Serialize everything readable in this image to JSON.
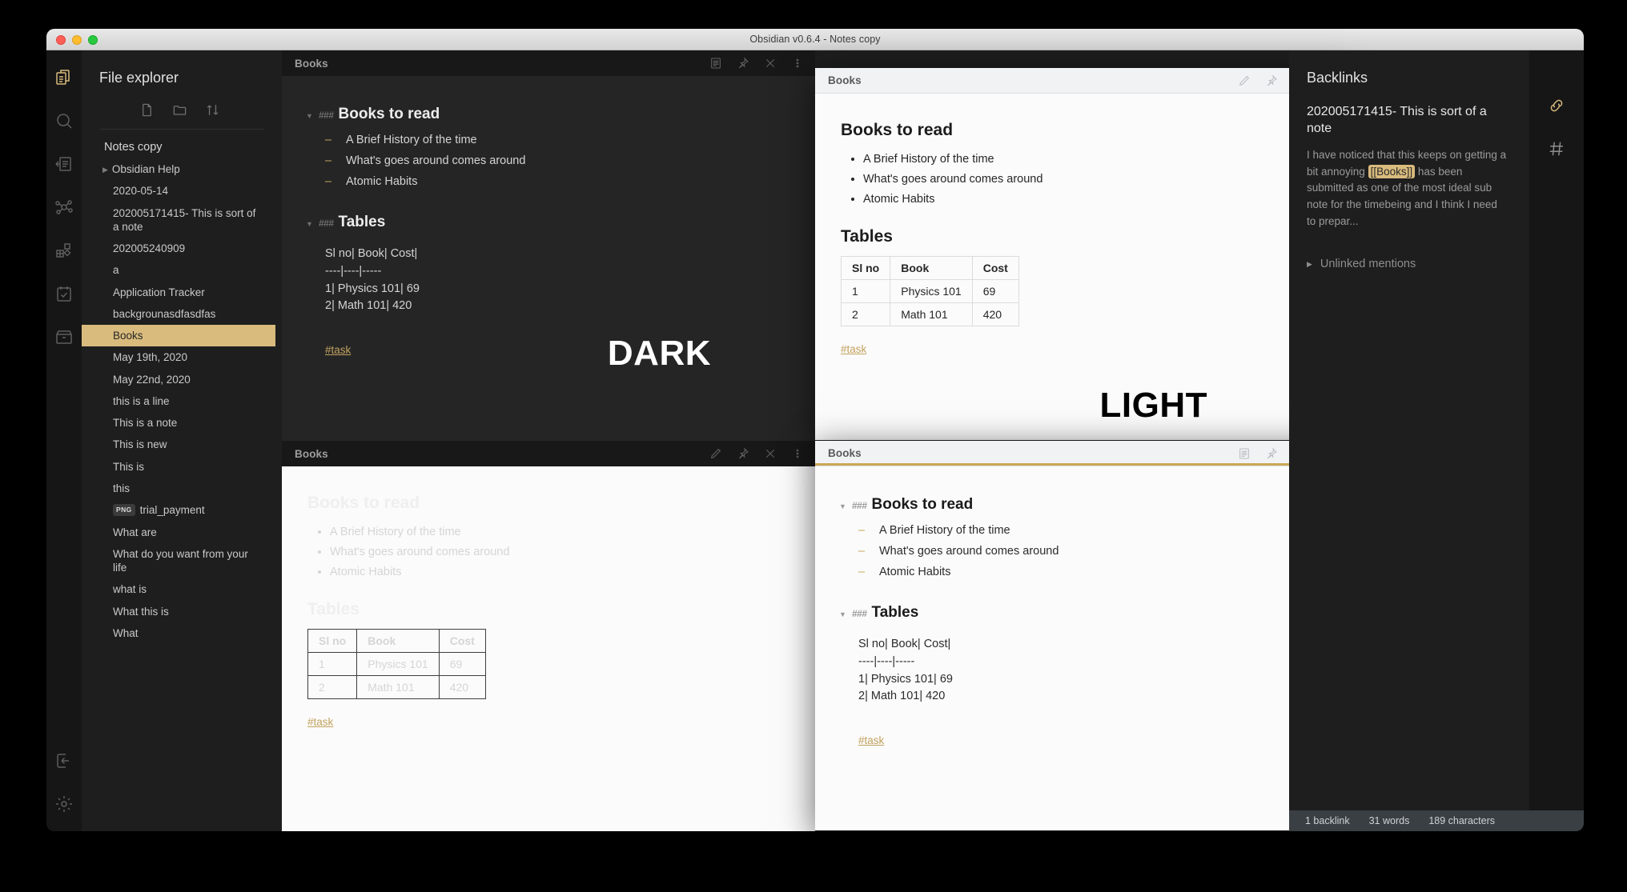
{
  "window": {
    "title": "Obsidian v0.6.4 - Notes copy"
  },
  "sidebar": {
    "title": "File explorer",
    "vault": "Notes copy",
    "tools": [
      {
        "name": "new-note-icon",
        "label": "New note"
      },
      {
        "name": "new-folder-icon",
        "label": "New folder"
      },
      {
        "name": "sort-icon",
        "label": "Change sort order"
      }
    ],
    "rail_icons": [
      {
        "name": "file-explorer-icon",
        "label": "File explorer",
        "active": true
      },
      {
        "name": "search-icon",
        "label": "Search"
      },
      {
        "name": "quick-switcher-icon",
        "label": "Quick switcher"
      },
      {
        "name": "graph-view-icon",
        "label": "Graph view"
      },
      {
        "name": "plugins-icon",
        "label": "Plugins"
      },
      {
        "name": "daily-note-icon",
        "label": "Daily note"
      },
      {
        "name": "archive-icon",
        "label": "Archive"
      }
    ],
    "rail_bottom_icons": [
      {
        "name": "open-vault-icon",
        "label": "Open another vault"
      },
      {
        "name": "settings-gear-icon",
        "label": "Settings"
      }
    ],
    "items": [
      {
        "label": "Obsidian Help",
        "type": "folder",
        "collapsed": true
      },
      {
        "label": "2020-05-14",
        "type": "file"
      },
      {
        "label": "202005171415- This is sort of a note",
        "type": "file"
      },
      {
        "label": "202005240909",
        "type": "file"
      },
      {
        "label": "a",
        "type": "file"
      },
      {
        "label": "Application Tracker",
        "type": "file"
      },
      {
        "label": "backgrounasdfasdfas",
        "type": "file"
      },
      {
        "label": "Books",
        "type": "file",
        "selected": true
      },
      {
        "label": "May 19th, 2020",
        "type": "file"
      },
      {
        "label": "May 22nd, 2020",
        "type": "file"
      },
      {
        "label": "this is a line",
        "type": "file"
      },
      {
        "label": "This is a note",
        "type": "file"
      },
      {
        "label": "This is new",
        "type": "file"
      },
      {
        "label": "This is",
        "type": "file"
      },
      {
        "label": "this",
        "type": "file"
      },
      {
        "label": "trial_payment",
        "type": "image",
        "badge": "PNG"
      },
      {
        "label": "What are",
        "type": "file"
      },
      {
        "label": "What do you want from your life",
        "type": "file"
      },
      {
        "label": "what is",
        "type": "file"
      },
      {
        "label": "What this is",
        "type": "file"
      },
      {
        "label": "What",
        "type": "file"
      }
    ]
  },
  "note": {
    "title": "Books",
    "heading_1": "Books to read",
    "heading_2": "Tables",
    "hash_prefix": "###",
    "bullets": [
      "A Brief History of the time",
      "What's goes around comes around",
      "Atomic Habits"
    ],
    "table": {
      "headers": [
        "Sl no",
        "Book",
        "Cost"
      ],
      "rows": [
        [
          "1",
          "Physics 101",
          "69"
        ],
        [
          "2",
          "Math 101",
          "420"
        ]
      ]
    },
    "table_source": [
      "Sl no| Book| Cost|",
      "----|----|-----",
      "1| Physics 101| 69",
      "2| Math 101| 420"
    ],
    "tag": "#task"
  },
  "panes": [
    {
      "id": "pane-dark-source",
      "title": "Books",
      "theme": "dark",
      "mode": "source",
      "active": false,
      "watermark": "DARK",
      "icons": [
        "preview-icon",
        "pin-icon",
        "close-icon",
        "more-options-icon"
      ]
    },
    {
      "id": "pane-dark-preview",
      "title": "Books",
      "theme": "dark",
      "mode": "preview",
      "active": false,
      "watermark": "",
      "icons": [
        "edit-pencil-icon",
        "pin-icon",
        "close-icon",
        "more-options-icon"
      ]
    },
    {
      "id": "pane-light-preview",
      "title": "Books",
      "theme": "light",
      "mode": "preview",
      "active": false,
      "watermark": "LIGHT",
      "icons": [
        "edit-pencil-icon",
        "pin-icon",
        "close-icon",
        "more-options-icon"
      ]
    },
    {
      "id": "pane-light-source",
      "title": "Books",
      "theme": "light",
      "mode": "source",
      "active": true,
      "watermark": "",
      "icons": [
        "preview-icon",
        "pin-icon",
        "close-icon",
        "more-options-icon"
      ]
    }
  ],
  "backlinks": {
    "title": "Backlinks",
    "note_title": "202005171415- This is sort of a note",
    "excerpt_before": "I have noticed that this keeps on getting a bit annoying ",
    "excerpt_link": "[[Books]]",
    "excerpt_after": " has been submitted as one of the most ideal sub note for the timebeing and I think I need to prepar...",
    "unlinked_mentions": "Unlinked mentions",
    "rail_icons": [
      {
        "name": "backlinks-link-icon",
        "label": "Backlinks",
        "active": true
      },
      {
        "name": "tags-hash-icon",
        "label": "Tags"
      }
    ]
  },
  "statusbar": {
    "backlinks": "1 backlink",
    "words": "31 words",
    "characters": "189 characters"
  },
  "colors": {
    "accent": "#d9bb7d",
    "tag": "#c3a25f",
    "dark_bg": "#252525",
    "light_bg": "#fbfbfb"
  }
}
